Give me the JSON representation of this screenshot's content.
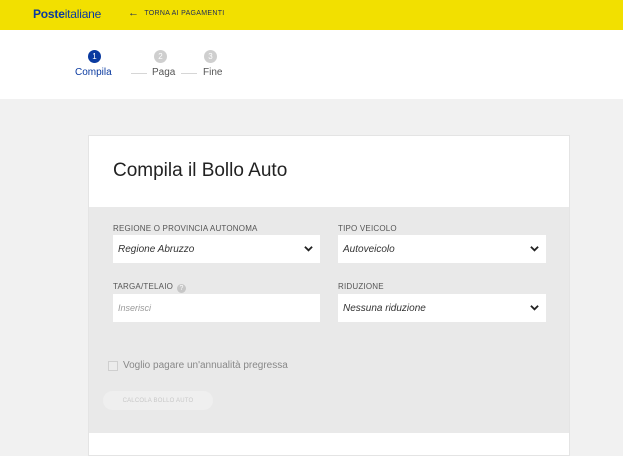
{
  "header": {
    "logo_bold": "Poste",
    "logo_light": "italiane",
    "back_label": "TORNA AI PAGAMENTI"
  },
  "steps": [
    {
      "number": "1",
      "label": "Compila",
      "active": true
    },
    {
      "number": "2",
      "label": "Paga",
      "active": false
    },
    {
      "number": "3",
      "label": "Fine",
      "active": false
    }
  ],
  "form": {
    "title": "Compila il Bollo Auto",
    "region": {
      "label": "REGIONE O PROVINCIA AUTONOMA",
      "value": "Regione Abruzzo"
    },
    "vehicle": {
      "label": "TIPO VEICOLO",
      "value": "Autoveicolo"
    },
    "plate": {
      "label": "TARGA/TELAIO",
      "placeholder": "Inserisci"
    },
    "reduction": {
      "label": "RIDUZIONE",
      "value": "Nessuna riduzione"
    },
    "past_year_checkbox": {
      "label": "Voglio pagare un'annualità pregressa",
      "checked": false
    },
    "submit_label": "CALCOLA BOLLO AUTO"
  },
  "colors": {
    "brand_yellow": "#f2e000",
    "brand_blue": "#0a3aa0"
  }
}
